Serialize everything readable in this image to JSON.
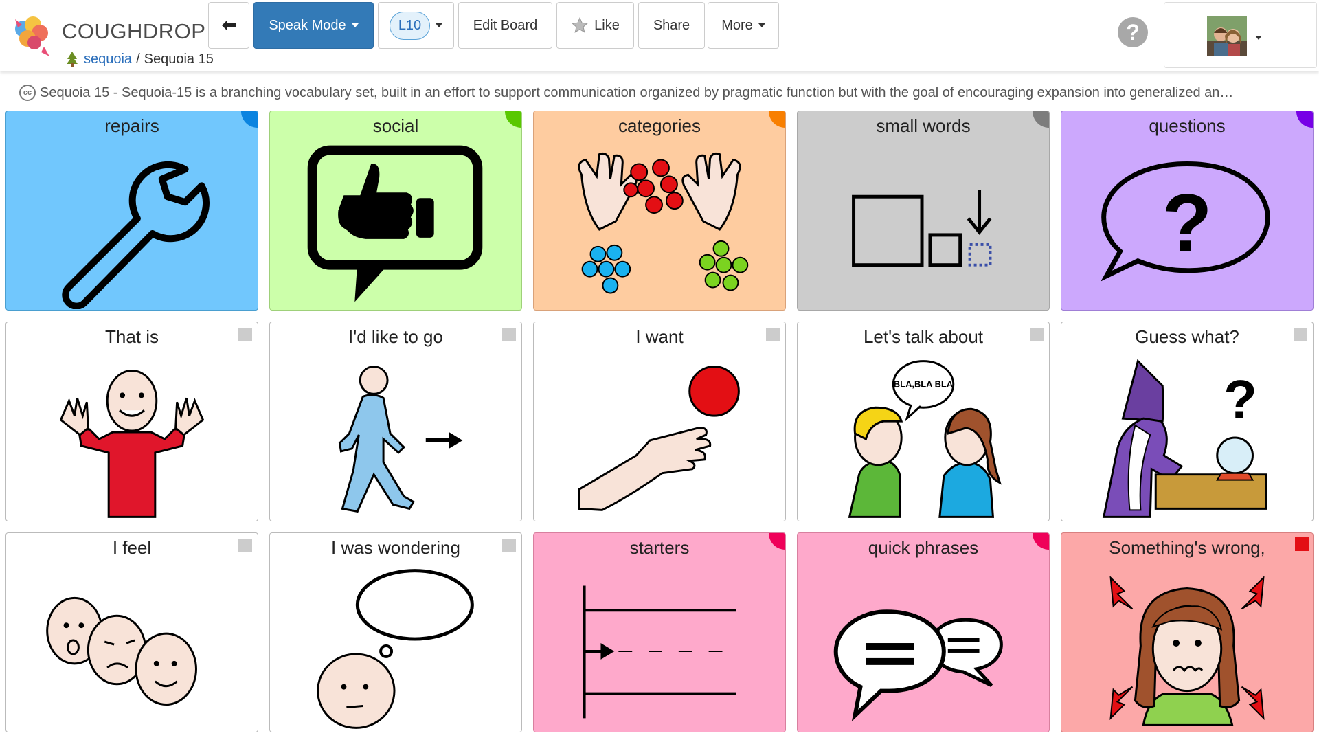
{
  "app": {
    "name": "COUGHDROP",
    "breadcrumb_user": "sequoia",
    "breadcrumb_sep": "/",
    "breadcrumb_board": "Sequoia 15"
  },
  "toolbar": {
    "speak_mode": "Speak Mode",
    "level": "L10",
    "edit_board": "Edit Board",
    "like": "Like",
    "share": "Share",
    "more": "More",
    "help": "?"
  },
  "board": {
    "description": "Sequoia 15 - Sequoia-15 is a branching vocabulary set, built in an effort to support communication organized by pragmatic function but with the goal of encouraging expansion into generalized an…",
    "cc_badge": "cc"
  },
  "tiles": [
    {
      "label": "repairs",
      "bg": "#71c7fd",
      "corner": "#0b84e0",
      "icon": "wrench-icon"
    },
    {
      "label": "social",
      "bg": "#ccffaa",
      "corner": "#59c800",
      "icon": "thumbs-up-speech-icon"
    },
    {
      "label": "categories",
      "bg": "#fecca0",
      "corner": "#f87f00",
      "icon": "sorting-hands-icon"
    },
    {
      "label": "small words",
      "bg": "#cccccc",
      "corner": "#7d7d7d",
      "icon": "small-squares-icon"
    },
    {
      "label": "questions",
      "bg": "#cca8fd",
      "corner": "#7700e6",
      "icon": "question-speech-icon"
    },
    {
      "label": "That is",
      "bg": "#ffffff",
      "icon": "presenting-person-icon"
    },
    {
      "label": "I'd like to go",
      "bg": "#ffffff",
      "icon": "walking-person-icon"
    },
    {
      "label": "I want",
      "bg": "#ffffff",
      "icon": "hand-reaching-ball-icon"
    },
    {
      "label": "Let's talk about",
      "bg": "#ffffff",
      "icon": "two-people-talking-icon"
    },
    {
      "label": "Guess what?",
      "bg": "#ffffff",
      "icon": "wizard-crystal-ball-icon"
    },
    {
      "label": "I feel",
      "bg": "#ffffff",
      "icon": "three-faces-icon"
    },
    {
      "label": "I was wondering",
      "bg": "#ffffff",
      "icon": "thinking-head-icon"
    },
    {
      "label": "starters",
      "bg": "#fea9cb",
      "corner": "#ef0059",
      "icon": "starting-line-icon"
    },
    {
      "label": "quick phrases",
      "bg": "#fea9cb",
      "corner": "#ef0059",
      "icon": "equal-speech-bubbles-icon"
    },
    {
      "label": "Something's wrong,",
      "bg": "#fca8a8",
      "corner": "#e30f14",
      "icon": "distressed-woman-icon"
    }
  ],
  "speech_text": "BLA,BLA BLA",
  "colors": {
    "primary": "#337ab7",
    "link": "#2a6ebb"
  }
}
